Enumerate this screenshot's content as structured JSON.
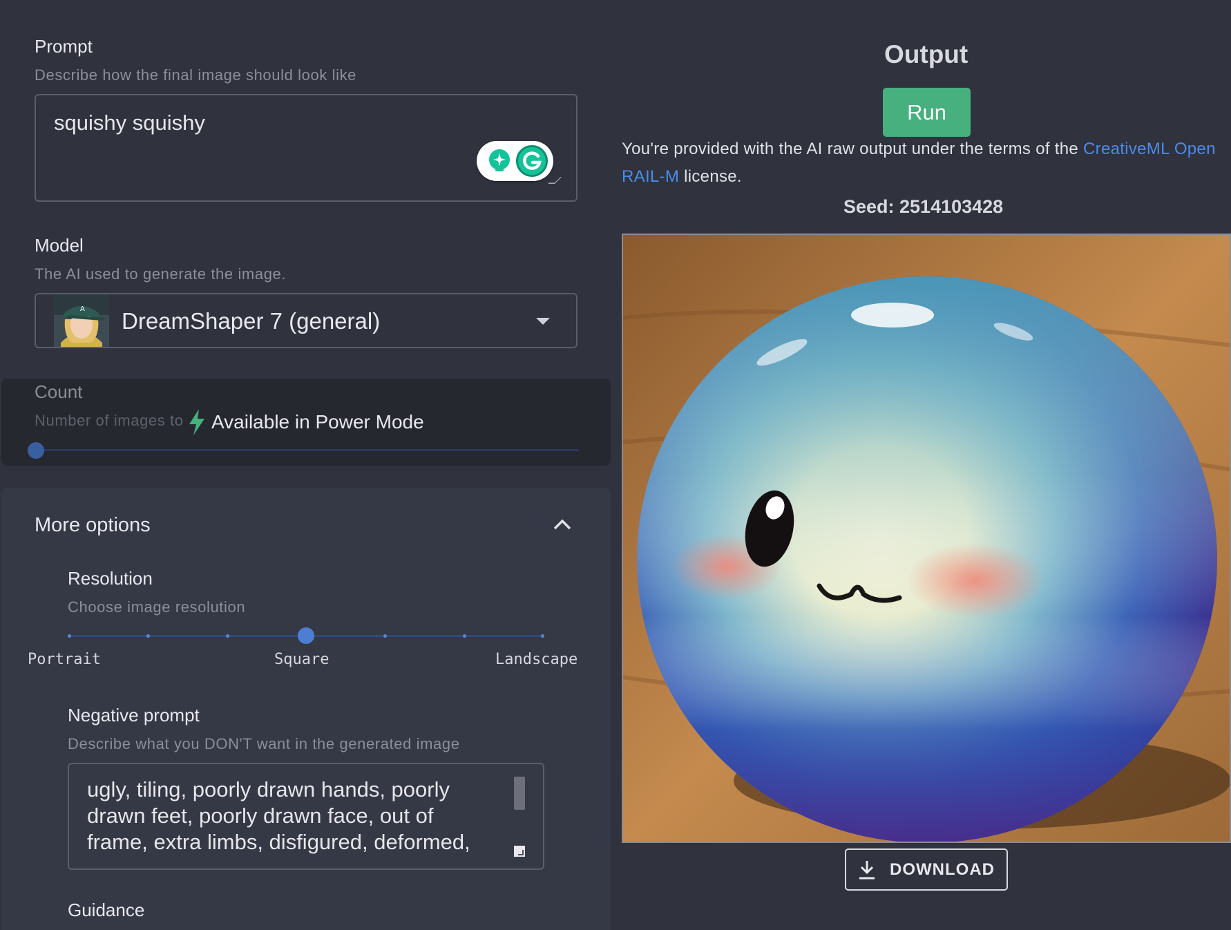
{
  "prompt": {
    "label": "Prompt",
    "description": "Describe how the final image should look like",
    "value": "squishy squishy"
  },
  "model": {
    "label": "Model",
    "description": "The AI used to generate the image.",
    "selected": "DreamShaper 7 (general)"
  },
  "count": {
    "label": "Count",
    "description": "Number of images to generate",
    "locked_message": "Available in Power Mode",
    "value": 1
  },
  "more_options": {
    "title": "More options",
    "resolution": {
      "label": "Resolution",
      "description": "Choose image resolution",
      "left_label": "Portrait",
      "center_label": "Square",
      "right_label": "Landscape",
      "selected": "Square"
    },
    "negative_prompt": {
      "label": "Negative prompt",
      "description": "Describe what you DON'T want in the generated image",
      "value": "ugly, tiling, poorly drawn hands, poorly drawn feet, poorly drawn face, out of frame, extra limbs, disfigured, deformed,"
    },
    "guidance_label": "Guidance"
  },
  "output": {
    "title": "Output",
    "run_label": "Run",
    "license_prefix": "You're provided with the AI raw output under the terms of the ",
    "license_link": "CreativeML Open RAIL-M",
    "license_suffix": " license.",
    "seed_text": "Seed: 2514103428",
    "download_label": "DOWNLOAD"
  },
  "colors": {
    "background": "#30323e",
    "accent_green": "#47b07f",
    "link_blue": "#4d8be8",
    "slider_blue": "#4c7fd4"
  }
}
